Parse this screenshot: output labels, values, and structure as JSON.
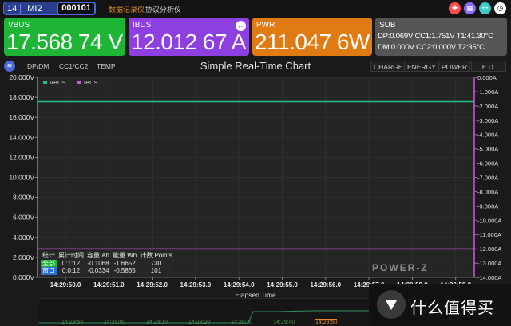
{
  "device": {
    "number": "14",
    "model": "MI2",
    "serial": "000101"
  },
  "modes": {
    "recorder": "数据记录仪",
    "analyzer": "协议分析仪"
  },
  "window_buttons": [
    {
      "icon": "gift-icon",
      "glyph": "✚",
      "color": "#ff4d4d"
    },
    {
      "icon": "grid-icon",
      "glyph": "▦",
      "color": "#8b6bff"
    },
    {
      "icon": "apps-icon",
      "glyph": "✣",
      "color": "#3fc8c8"
    },
    {
      "icon": "clock-icon",
      "glyph": "◷",
      "color": "#ffffff"
    }
  ],
  "meters": {
    "vbus": {
      "label": "VBUS",
      "value": "17.568 74 V"
    },
    "ibus": {
      "label": "IBUS",
      "value": "12.012 67 A"
    },
    "pwr": {
      "label": "PWR",
      "value": "211.047 6W"
    },
    "sub": {
      "label": "SUB",
      "line1": "DP:0.069V  CC1:1.751V  T1:41.30°C",
      "line2": "DM:0.000V  CC2:0.000V  T2:35°C"
    }
  },
  "chart_tabs": {
    "dpdm": "DP/DM",
    "cc": "CC1/CC2",
    "temp": "TEMP"
  },
  "chart_modes": {
    "charge": "CHARGE",
    "energy": "ENERGY",
    "power": "POWER",
    "ed": "E.D."
  },
  "chart_data": {
    "type": "line",
    "title": "Simple Real-Time Chart",
    "xlabel": "Elapsed Time",
    "x_ticks": [
      "14:29:50.0",
      "14:29:51.0",
      "14:29:52.0",
      "14:29:53.0",
      "14:29:54.0",
      "14:29:55.0",
      "14:29:56.0",
      "14:29:57.0",
      "14:29:58.0",
      "14:29:59.0"
    ],
    "y_left_ticks": [
      "20.000V",
      "18.000V",
      "16.000V",
      "14.000V",
      "12.000V",
      "10.000V",
      "8.000V",
      "6.000V",
      "4.000V",
      "2.000V",
      "0.000V"
    ],
    "y_right_ticks": [
      "0.000A",
      "-1.000A",
      "-2.000A",
      "-3.000A",
      "-4.000A",
      "-5.000A",
      "-6.000A",
      "-7.000A",
      "-8.000A",
      "-9.000A",
      "-10.000A",
      "-11.000A",
      "-12.000A",
      "-13.000A",
      "-14.000A"
    ],
    "ylim_left": [
      0,
      20
    ],
    "ylim_right": [
      -14,
      0
    ],
    "series": [
      {
        "name": "VBUS",
        "color": "#21c28a",
        "axis": "left",
        "value": 17.57
      },
      {
        "name": "IBUS",
        "color": "#c85ad8",
        "axis": "right",
        "value": -12.01
      }
    ]
  },
  "stats": {
    "headers": [
      "统计",
      "累计时间",
      "容量 Ah",
      "能量 Wh",
      "计数 Points"
    ],
    "rows": [
      {
        "tag": "全部",
        "time": "0:1:12",
        "capacity": "-0.1068",
        "energy": "-1.6652",
        "points": "730"
      },
      {
        "tag": "窗口",
        "time": "0:0:12",
        "capacity": "-0.0334",
        "energy": "-0.5865",
        "points": "101"
      }
    ]
  },
  "watermark": "POWER-Z",
  "overview_ticks": [
    "14:28:50",
    "14:29:00",
    "14:29:10",
    "14:29:20",
    "14:29:30",
    "14:29:40",
    "14:29:50"
  ],
  "brand": "什么值得买"
}
